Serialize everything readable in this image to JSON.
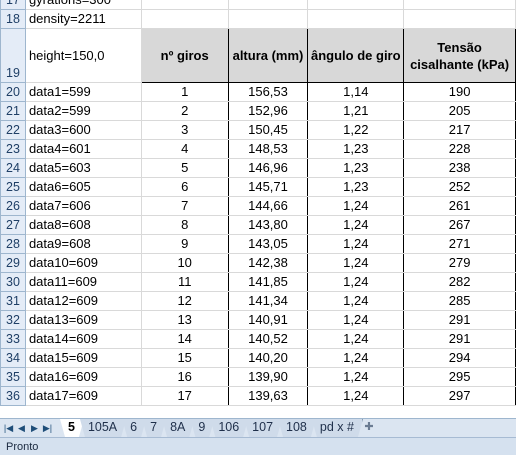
{
  "sheet": {
    "top_cells": [
      {
        "row": "17",
        "text": "gyrations=300"
      },
      {
        "row": "18",
        "text": "density=2211"
      }
    ],
    "header_row": {
      "row": "19",
      "a_text": "height=150,0",
      "columns": [
        "nº giros",
        "altura (mm)",
        "ângulo de giro",
        "Tensão cisalhante (kPa)"
      ]
    },
    "rows": [
      {
        "row": "20",
        "label": "data1=599",
        "giros": "1",
        "altura": "156,53",
        "angulo": "1,14",
        "tensao": "190"
      },
      {
        "row": "21",
        "label": "data2=599",
        "giros": "2",
        "altura": "152,96",
        "angulo": "1,21",
        "tensao": "205"
      },
      {
        "row": "22",
        "label": "data3=600",
        "giros": "3",
        "altura": "150,45",
        "angulo": "1,22",
        "tensao": "217"
      },
      {
        "row": "23",
        "label": "data4=601",
        "giros": "4",
        "altura": "148,53",
        "angulo": "1,23",
        "tensao": "228"
      },
      {
        "row": "24",
        "label": "data5=603",
        "giros": "5",
        "altura": "146,96",
        "angulo": "1,23",
        "tensao": "238"
      },
      {
        "row": "25",
        "label": "data6=605",
        "giros": "6",
        "altura": "145,71",
        "angulo": "1,23",
        "tensao": "252"
      },
      {
        "row": "26",
        "label": "data7=606",
        "giros": "7",
        "altura": "144,66",
        "angulo": "1,24",
        "tensao": "261"
      },
      {
        "row": "27",
        "label": "data8=608",
        "giros": "8",
        "altura": "143,80",
        "angulo": "1,24",
        "tensao": "267"
      },
      {
        "row": "28",
        "label": "data9=608",
        "giros": "9",
        "altura": "143,05",
        "angulo": "1,24",
        "tensao": "271"
      },
      {
        "row": "29",
        "label": "data10=609",
        "giros": "10",
        "altura": "142,38",
        "angulo": "1,24",
        "tensao": "279"
      },
      {
        "row": "30",
        "label": "data11=609",
        "giros": "11",
        "altura": "141,85",
        "angulo": "1,24",
        "tensao": "282"
      },
      {
        "row": "31",
        "label": "data12=609",
        "giros": "12",
        "altura": "141,34",
        "angulo": "1,24",
        "tensao": "285"
      },
      {
        "row": "32",
        "label": "data13=609",
        "giros": "13",
        "altura": "140,91",
        "angulo": "1,24",
        "tensao": "291"
      },
      {
        "row": "33",
        "label": "data14=609",
        "giros": "14",
        "altura": "140,52",
        "angulo": "1,24",
        "tensao": "291"
      },
      {
        "row": "34",
        "label": "data15=609",
        "giros": "15",
        "altura": "140,20",
        "angulo": "1,24",
        "tensao": "294"
      },
      {
        "row": "35",
        "label": "data16=609",
        "giros": "16",
        "altura": "139,90",
        "angulo": "1,24",
        "tensao": "295"
      },
      {
        "row": "36",
        "label": "data17=609",
        "giros": "17",
        "altura": "139,63",
        "angulo": "1,24",
        "tensao": "297"
      }
    ]
  },
  "tabs": {
    "nav_icons": [
      "first-sheet-icon",
      "prev-sheet-icon",
      "next-sheet-icon",
      "last-sheet-icon"
    ],
    "items": [
      "5",
      "105A",
      "6",
      "7",
      "8A",
      "9",
      "106",
      "107",
      "108",
      "pd x #"
    ],
    "active": "5",
    "new_sheet_icon": "insert-sheet-icon"
  },
  "status": {
    "text": "Pronto"
  }
}
